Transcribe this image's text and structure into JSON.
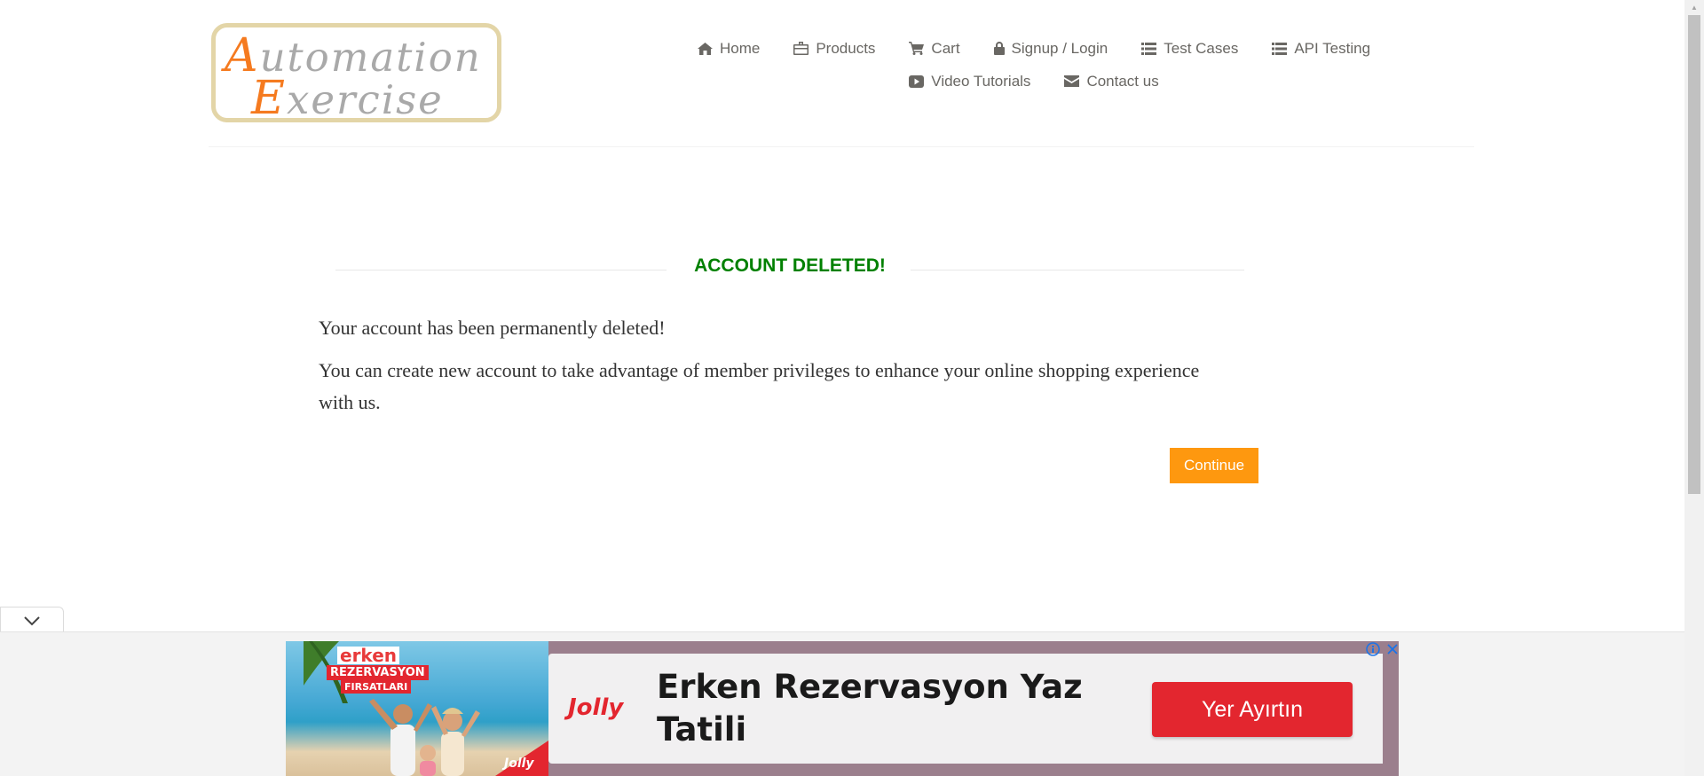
{
  "header": {
    "logo": {
      "line1": "Automation",
      "line2": "Exercise"
    },
    "nav": {
      "home": "Home",
      "products": "Products",
      "cart": "Cart",
      "signup_login": "Signup / Login",
      "test_cases": "Test Cases",
      "api_testing": "API Testing",
      "video_tutorials": "Video Tutorials",
      "contact_us": "Contact us"
    }
  },
  "main": {
    "title": "ACCOUNT DELETED!",
    "message1": "Your account has been permanently deleted!",
    "message2": "You can create new account to take advantage of member privileges to enhance your online shopping experience with us.",
    "continue_label": "Continue"
  },
  "ad": {
    "badge_line1": "erken",
    "badge_line2": "REZERVASYON",
    "badge_line3": "FIRSATLARI",
    "corner_brand": "Jolly",
    "brand": "Jolly",
    "headline": "Erken Rezervasyon Yaz Tatili",
    "cta": "Yer Ayırtın"
  },
  "colors": {
    "accent_orange": "#fe980f",
    "title_green": "#008000",
    "ad_red": "#e3262f"
  }
}
